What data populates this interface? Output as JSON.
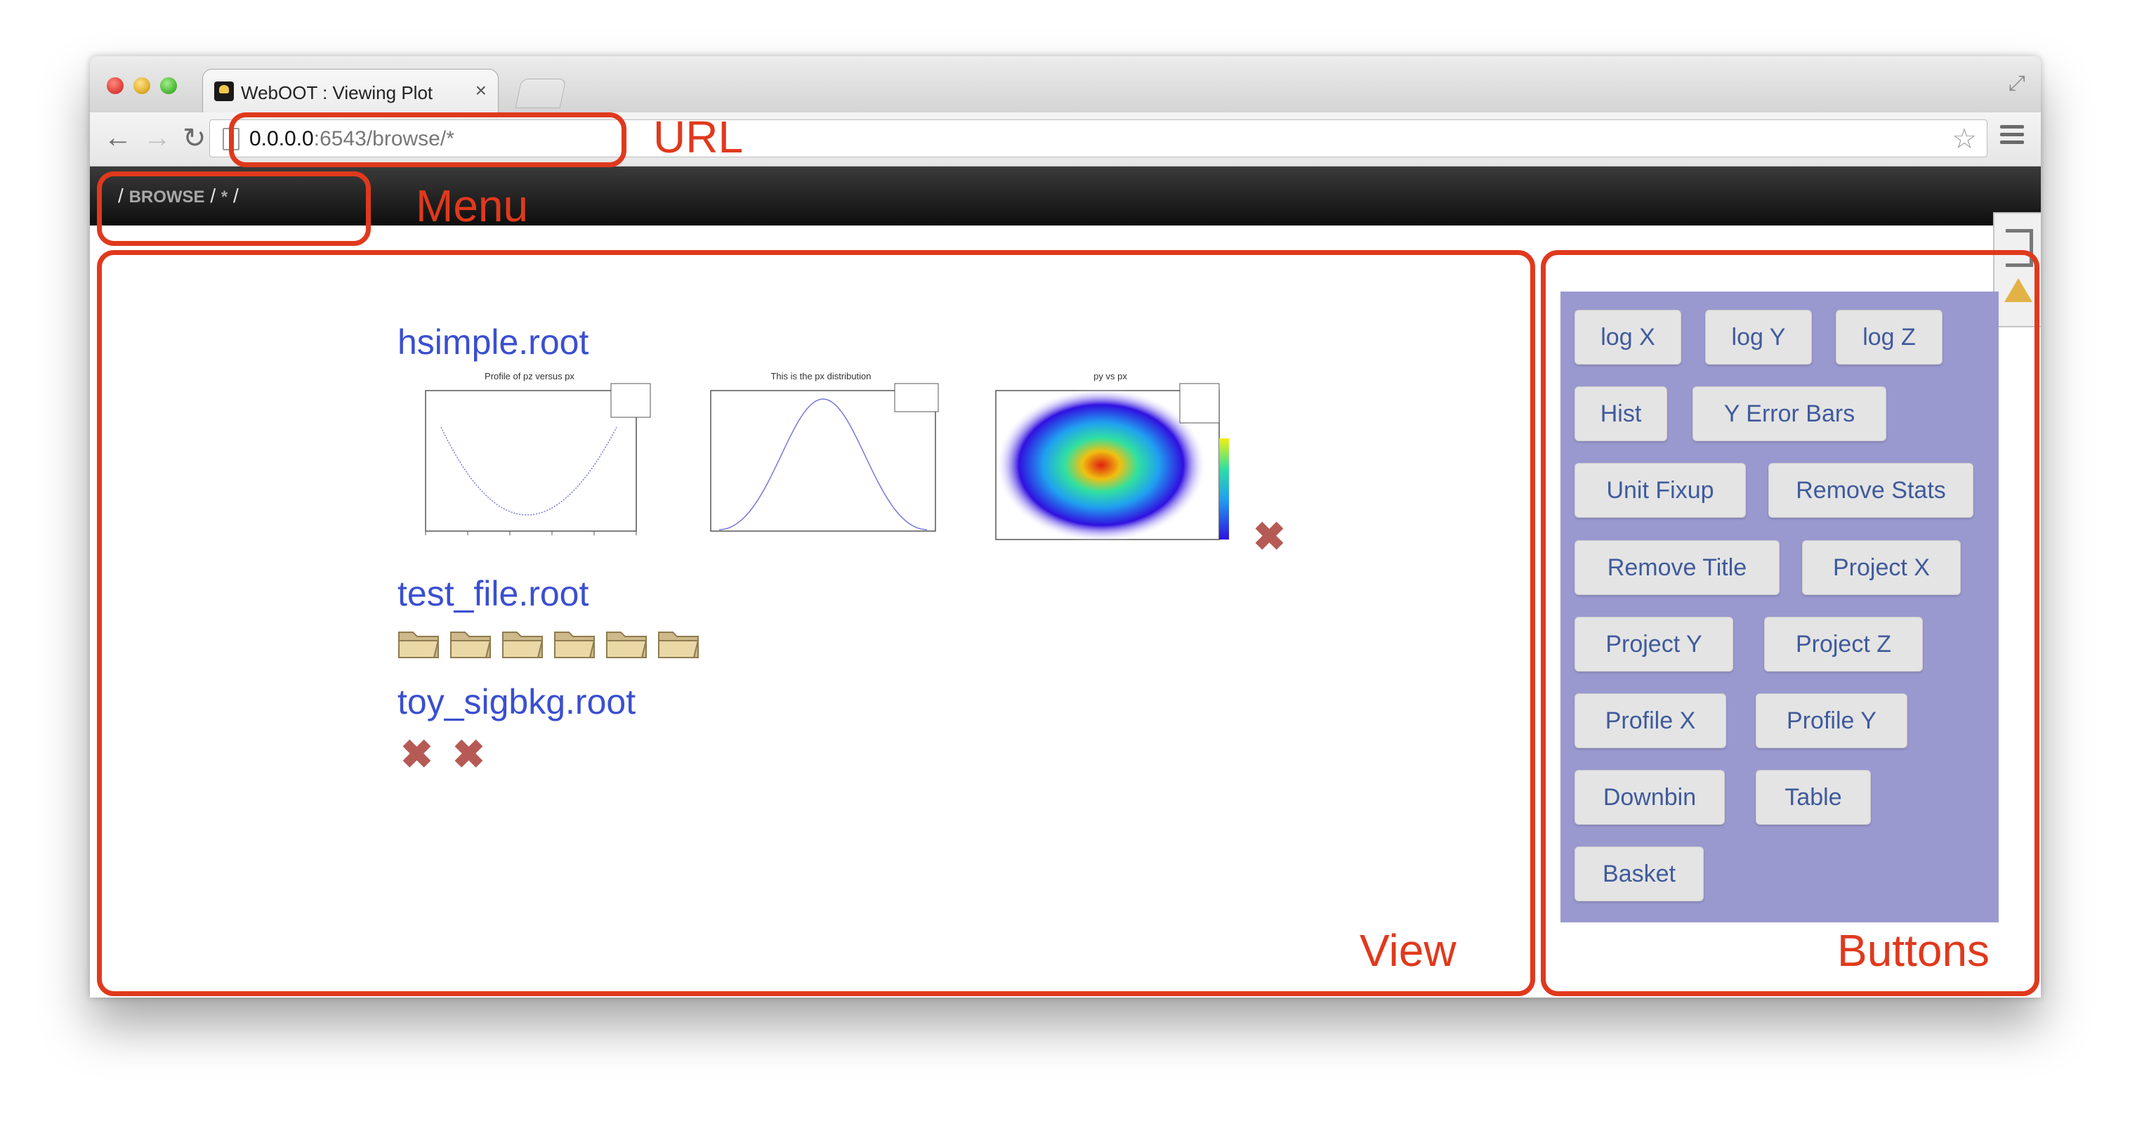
{
  "browser": {
    "tab_title": "WebOOT : Viewing Plot",
    "tab_close": "×",
    "url_host": "0.0.0.0",
    "url_path": ":6543/browse/*"
  },
  "menu": {
    "sep1": "/",
    "browse": "BROWSE",
    "sep2": "/",
    "star": "*",
    "sep3": "/"
  },
  "files": [
    {
      "name": "hsimple.root",
      "plots": [
        {
          "title": "Profile of pz versus px",
          "icon": "profile-plot"
        },
        {
          "title": "This is the px distribution",
          "icon": "histogram-plot"
        },
        {
          "title": "py vs px",
          "icon": "2d-heatmap-plot"
        }
      ],
      "x_count": 1
    },
    {
      "name": "test_file.root",
      "folder_count": 6
    },
    {
      "name": "toy_sigbkg.root",
      "x_count": 2
    }
  ],
  "buttons": [
    "log X",
    "log Y",
    "log Z",
    "Hist",
    "Y Error Bars",
    "Unit Fixup",
    "Remove Stats",
    "Remove Title",
    "Project X",
    "Project Y",
    "Project Z",
    "Profile X",
    "Profile Y",
    "Downbin",
    "Table",
    "Basket"
  ],
  "annotations": {
    "url": "URL",
    "menu": "Menu",
    "view": "View",
    "buttons": "Buttons"
  },
  "colors": {
    "annotation": "#e0391d",
    "link": "#3a4fd0",
    "button_panel": "#9999d0",
    "button_text": "#3f5a9c"
  }
}
